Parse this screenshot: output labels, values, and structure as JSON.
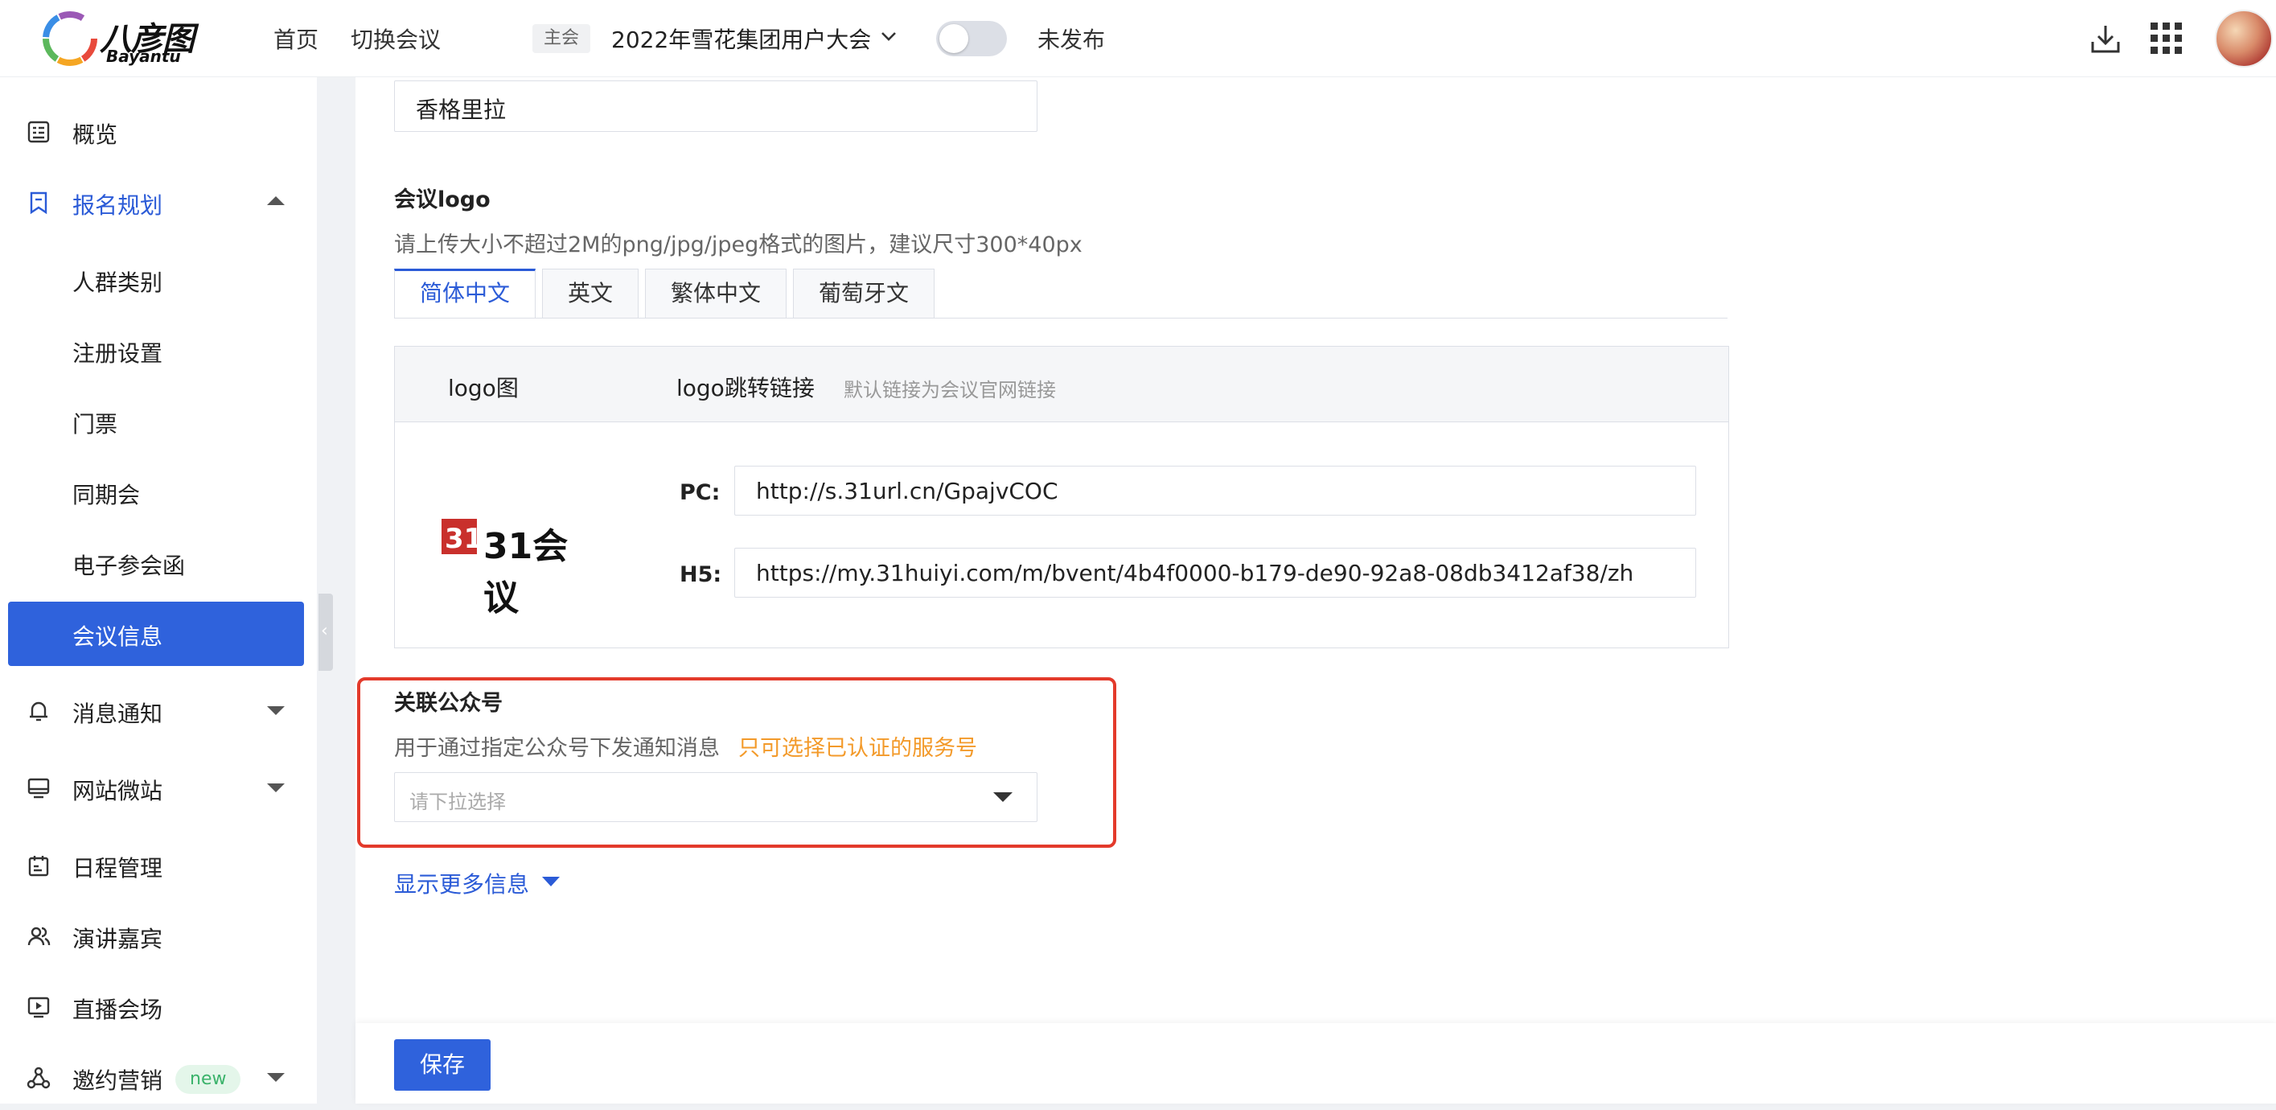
{
  "header": {
    "logo_cn": "八彦图",
    "logo_en": "Bayantu",
    "nav": [
      "首页",
      "切换会议"
    ],
    "main_badge": "主会",
    "conference_name": "2022年雪花集团用户大会",
    "publish_status": "未发布",
    "publish_toggle_on": false
  },
  "sidebar": {
    "items": [
      {
        "label": "概览",
        "icon": "overview-icon"
      },
      {
        "label": "报名规划",
        "icon": "bookmark-icon",
        "expanded": true
      },
      {
        "label": "人群类别"
      },
      {
        "label": "注册设置"
      },
      {
        "label": "门票"
      },
      {
        "label": "同期会"
      },
      {
        "label": "电子参会函"
      },
      {
        "label": "会议信息",
        "selected": true
      },
      {
        "label": "消息通知",
        "icon": "bell-icon"
      },
      {
        "label": "网站微站",
        "icon": "monitor-icon"
      },
      {
        "label": "日程管理",
        "icon": "calendar-icon"
      },
      {
        "label": "演讲嘉宾",
        "icon": "people-icon"
      },
      {
        "label": "直播会场",
        "icon": "live-icon"
      },
      {
        "label": "邀约营销",
        "icon": "network-icon",
        "badge": "new"
      }
    ]
  },
  "form": {
    "venue_value": "香格里拉",
    "logo_section": {
      "title": "会议logo",
      "hint": "请上传大小不超过2M的png/jpg/jpeg格式的图片，建议尺寸300*40px",
      "tabs": [
        "简体中文",
        "英文",
        "繁体中文",
        "葡萄牙文"
      ],
      "active_tab": "简体中文",
      "table_head": {
        "logo_col": "logo图",
        "link_col": "logo跳转链接",
        "link_hint": "默认链接为会议官网链接"
      },
      "logo_image_text": "31会议",
      "pc_label": "PC:",
      "pc_url": "http://s.31url.cn/GpajvCOC",
      "h5_label": "H5:",
      "h5_url": "https://my.31huiyi.com/m/bvent/4b4f0000-b179-de90-92a8-08db3412af38/zh"
    },
    "official_account": {
      "title": "关联公众号",
      "hint": "用于通过指定公众号下发通知消息",
      "warning": "只可选择已认证的服务号",
      "placeholder": "请下拉选择"
    },
    "show_more": "显示更多信息",
    "save": "保存"
  },
  "colors": {
    "accent": "#2f62dc",
    "highlight": "#e33a2b",
    "warning": "#f39a2a",
    "new_badge": "#3bb36b"
  }
}
